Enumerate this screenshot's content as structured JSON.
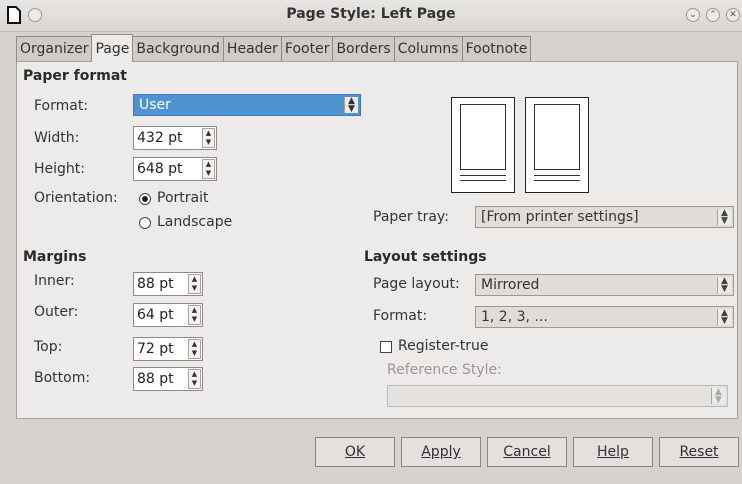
{
  "window": {
    "title": "Page Style: Left Page"
  },
  "tabs": [
    "Organizer",
    "Page",
    "Background",
    "Header",
    "Footer",
    "Borders",
    "Columns",
    "Footnote"
  ],
  "active_tab": "Page",
  "paper_format": {
    "heading": "Paper format",
    "format_label": "Format:",
    "format_value": "User",
    "width_label": "Width:",
    "width_value": "432 pt",
    "height_label": "Height:",
    "height_value": "648 pt",
    "orientation_label": "Orientation:",
    "portrait_label": "Portrait",
    "landscape_label": "Landscape",
    "orientation_selected": "Portrait"
  },
  "paper_tray": {
    "label": "Paper tray:",
    "value": "[From printer settings]"
  },
  "margins": {
    "heading": "Margins",
    "inner_label": "Inner:",
    "inner_value": "88 pt",
    "outer_label": "Outer:",
    "outer_value": "64 pt",
    "top_label": "Top:",
    "top_value": "72 pt",
    "bottom_label": "Bottom:",
    "bottom_value": "88 pt"
  },
  "layout_settings": {
    "heading": "Layout settings",
    "page_layout_label": "Page layout:",
    "page_layout_value": "Mirrored",
    "format_label": "Format:",
    "format_value": "1, 2, 3, ...",
    "register_true_label": "Register-true",
    "register_true_checked": false,
    "reference_style_label": "Reference Style:",
    "reference_style_value": ""
  },
  "buttons": {
    "ok": "OK",
    "apply": "Apply",
    "cancel": "Cancel",
    "help": "Help",
    "reset": "Reset"
  },
  "colors": {
    "highlight": "#4f93d3",
    "panel": "#edebe9",
    "window": "#d6d3cf"
  }
}
